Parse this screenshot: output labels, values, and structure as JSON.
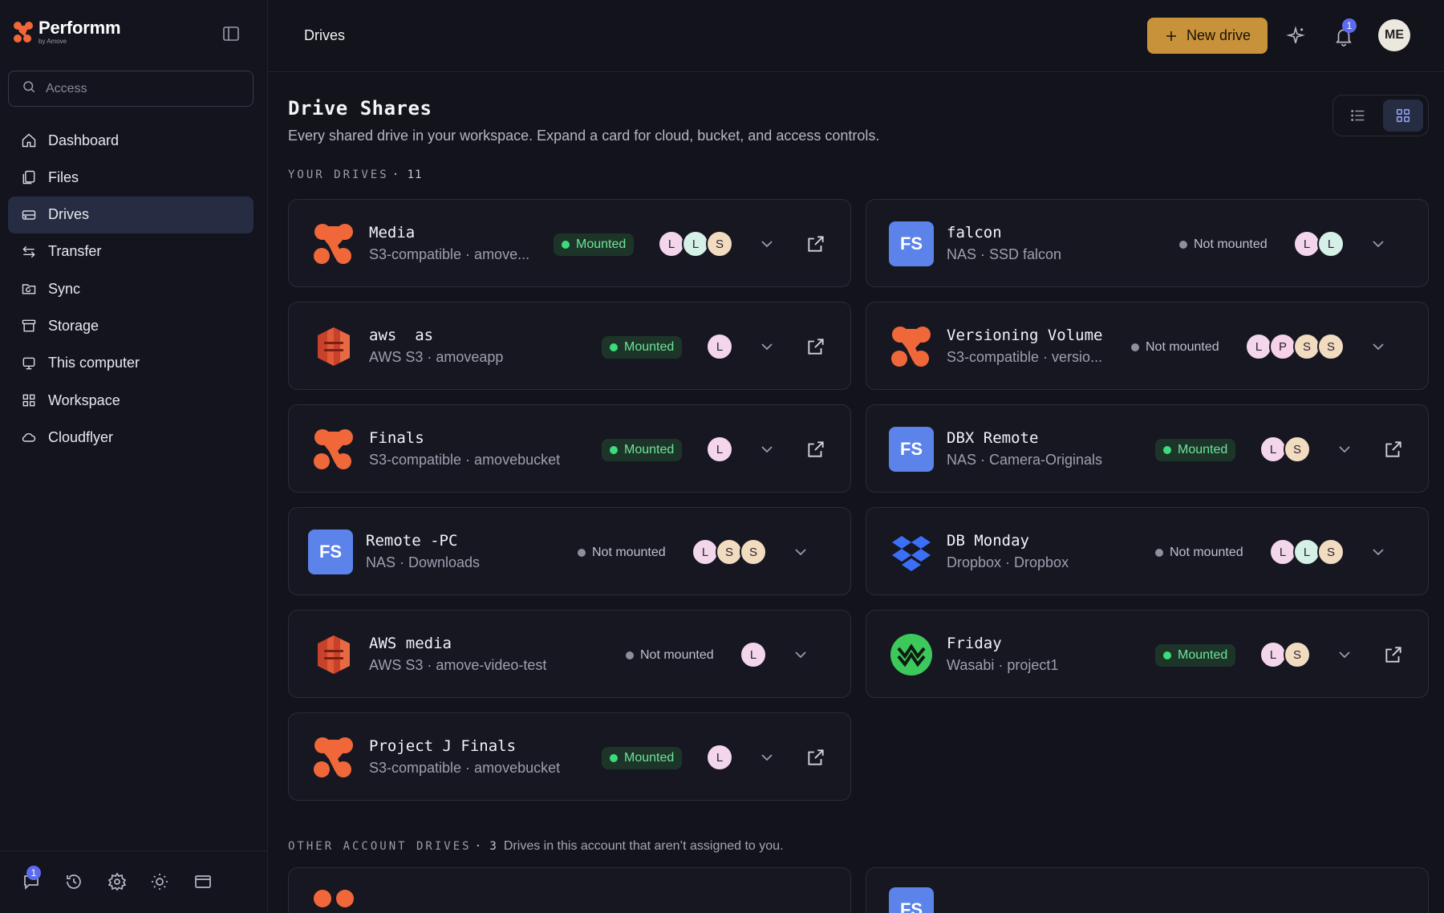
{
  "brand": {
    "name": "Performm",
    "sub": "by Amove"
  },
  "search": {
    "placeholder": "Access"
  },
  "nav": [
    {
      "label": "Dashboard",
      "icon": "home-icon"
    },
    {
      "label": "Files",
      "icon": "files-icon"
    },
    {
      "label": "Drives",
      "icon": "drive-icon",
      "active": true
    },
    {
      "label": "Transfer",
      "icon": "transfer-icon"
    },
    {
      "label": "Sync",
      "icon": "sync-icon"
    },
    {
      "label": "Storage",
      "icon": "storage-icon"
    },
    {
      "label": "This computer",
      "icon": "computer-icon"
    },
    {
      "label": "Workspace",
      "icon": "grid-icon"
    },
    {
      "label": "Cloudflyer",
      "icon": "cloud-icon"
    }
  ],
  "footer": {
    "chat_badge": "1"
  },
  "topbar": {
    "title": "Drives",
    "new_drive_label": "New drive",
    "notif_badge": "1",
    "avatar": "ME"
  },
  "page": {
    "title": "Drive Shares",
    "subtitle": "Every shared drive in your workspace. Expand a card for cloud, bucket, and access controls.",
    "your_drives_label": "YOUR DRIVES",
    "your_drives_count": "· 11",
    "other_label": "OTHER ACCOUNT DRIVES",
    "other_count": "· 3",
    "other_desc": "Drives in this account that aren’t assigned to you."
  },
  "colors": {
    "accent": "#c8923a",
    "mounted": "#3ddc7a",
    "fs_blue": "#5b83ea",
    "amove_orange": "#f0683a",
    "active_nav": "#262c42"
  },
  "drives": [
    {
      "name": "Media",
      "meta": "S3-compatible · amove...",
      "status": "Mounted",
      "users": [
        "L",
        "L",
        "S"
      ],
      "logo": "amove-logo",
      "external": true
    },
    {
      "name": "falcon",
      "meta": "NAS · SSD falcon",
      "status": "Not mounted",
      "users": [
        "L",
        "L"
      ],
      "logo": "fs-logo",
      "external": false
    },
    {
      "name": "aws  as",
      "meta": "AWS S3 · amoveapp",
      "status": "Mounted",
      "users": [
        "L"
      ],
      "logo": "aws-s3-logo",
      "external": true
    },
    {
      "name": "Versioning Volume",
      "meta": "S3-compatible · versio...",
      "status": "Not mounted",
      "users": [
        "L",
        "P",
        "S",
        "S"
      ],
      "logo": "amove-logo",
      "external": false
    },
    {
      "name": "Finals",
      "meta": "S3-compatible · amovebucket",
      "status": "Mounted",
      "users": [
        "L"
      ],
      "logo": "amove-logo",
      "external": true
    },
    {
      "name": "DBX Remote",
      "meta": "NAS · Camera-Originals",
      "status": "Mounted",
      "users": [
        "L",
        "S"
      ],
      "logo": "fs-logo",
      "external": true
    },
    {
      "name": "Remote -PC",
      "meta": "NAS · Downloads",
      "status": "Not mounted",
      "users": [
        "L",
        "S",
        "S"
      ],
      "logo": "fs-logo",
      "external": false
    },
    {
      "name": "DB Monday",
      "meta": "Dropbox · Dropbox",
      "status": "Not mounted",
      "users": [
        "L",
        "L",
        "S"
      ],
      "logo": "dropbox-logo",
      "external": false
    },
    {
      "name": "AWS media",
      "meta": "AWS S3 · amove-video-test",
      "status": "Not mounted",
      "users": [
        "L"
      ],
      "logo": "aws-s3-logo",
      "external": false
    },
    {
      "name": "Friday",
      "meta": "Wasabi · project1",
      "status": "Mounted",
      "users": [
        "L",
        "S"
      ],
      "logo": "wasabi-logo",
      "external": true
    },
    {
      "name": "Project J Finals",
      "meta": "S3-compatible · amovebucket",
      "status": "Mounted",
      "users": [
        "L"
      ],
      "logo": "amove-logo",
      "external": true
    }
  ],
  "fs_text": "FS"
}
